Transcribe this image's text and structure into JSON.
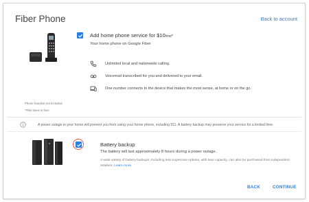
{
  "header": {
    "title": "Fiber Phone",
    "back_to_account": "Back to account"
  },
  "home_phone": {
    "checked": true,
    "title_main": "Add home phone service for $10",
    "title_unit": "/mo*",
    "description": "Your home phone on Google Fiber",
    "features": [
      {
        "icon": "phone-icon",
        "text": "Unlimited local and nationwide calling."
      },
      {
        "icon": "voicemail-icon",
        "text": "Voicemail transcribed for you and delivered to your email."
      },
      {
        "icon": "devices-icon",
        "text": "One number connects to the device that makes the most sense, at home or on the go."
      }
    ],
    "notes": [
      "Phone handset not included.",
      "*Plus taxes & fees"
    ]
  },
  "outage_notice": "A power outage in your home will prevent you from using your home phone, including 911. A battery backup may preserve your service for a limited time.",
  "battery_backup": {
    "checked": true,
    "title": "Battery backup",
    "description": "The battery will last approximately 8 hours during a power outage.",
    "more_info": "A wide variety of battery backups, including less expensive options, with less capacity, can also be purchased from independent retailers.",
    "learn_more": "Learn more"
  },
  "footer": {
    "back_label": "BACK",
    "continue_label": "CONTINUE"
  },
  "colors": {
    "accent": "#2a7de1",
    "highlight_ring": "#e45a3c"
  }
}
